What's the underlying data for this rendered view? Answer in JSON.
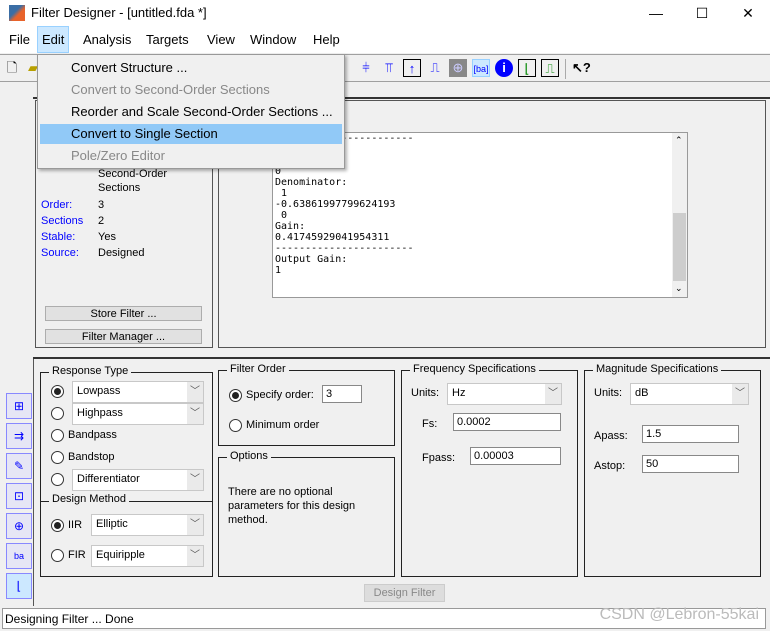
{
  "window": {
    "title": "Filter Designer -  [untitled.fda *]",
    "controls": [
      "—",
      "☐",
      "✕"
    ]
  },
  "menubar": [
    "File",
    "Edit",
    "Analysis",
    "Targets",
    "View",
    "Window",
    "Help"
  ],
  "edit_menu": {
    "items": [
      {
        "label": "Convert Structure ...",
        "enabled": true
      },
      {
        "label": "Convert to Second-Order Sections",
        "enabled": false
      },
      {
        "label": "Reorder and Scale Second-Order Sections ...",
        "enabled": true
      },
      {
        "label": "Convert to Single Section",
        "enabled": true,
        "highlighted": true
      },
      {
        "label": "Pole/Zero Editor",
        "enabled": false
      }
    ]
  },
  "toolbar": {
    "icons": [
      "new-file-icon",
      "open-file-icon",
      "phase-delay-icon",
      "group-delay-icon",
      "impulse-response-icon",
      "step-response-icon",
      "pole-zero-icon",
      "filter-coefficients-icon",
      "filter-information-icon",
      "magnitude-estimate-icon",
      "round-off-noise-icon",
      "whats-this-help-icon"
    ]
  },
  "filter_info": {
    "structure_tail": "Second-Order\nSections",
    "fields": [
      {
        "label": "Order:",
        "value": "3"
      },
      {
        "label": "Sections",
        "value": "2"
      },
      {
        "label": "Stable:",
        "value": "Yes"
      },
      {
        "label": "Source:",
        "value": "Designed"
      }
    ],
    "store_button": "Store Filter ...",
    "manager_button": "Filter Manager ..."
  },
  "coefficients_text": "-----------------------\n1\n1\n0\nDenominator:\n 1\n-0.63861997799624193\n 0\nGain:\n0.41745929041954311\n-----------------------\nOutput Gain:\n1",
  "response_type": {
    "title": "Response Type",
    "lowpass": "Lowpass",
    "highpass": "Highpass",
    "bandpass": "Bandpass",
    "bandstop": "Bandstop",
    "differentiator": "Differentiator",
    "selected": "Lowpass"
  },
  "design_method": {
    "title": "Design Method",
    "iir_label": "IIR",
    "iir_value": "Elliptic",
    "fir_label": "FIR",
    "fir_value": "Equiripple",
    "selected": "IIR"
  },
  "filter_order": {
    "title": "Filter Order",
    "specify_label": "Specify order:",
    "specify_value": "3",
    "minimum_label": "Minimum order",
    "selected": "specify"
  },
  "options": {
    "title": "Options",
    "text": "There are no optional parameters for this design method."
  },
  "frequency_specs": {
    "title": "Frequency Specifications",
    "units_label": "Units:",
    "units": "Hz",
    "fs_label": "Fs:",
    "fs": "0.0002",
    "fpass_label": "Fpass:",
    "fpass": "0.00003"
  },
  "magnitude_specs": {
    "title": "Magnitude Specifications",
    "units_label": "Units:",
    "units": "dB",
    "apass_label": "Apass:",
    "apass": "1.5",
    "astop_label": "Astop:",
    "astop": "50"
  },
  "design_button": "Design Filter",
  "status": "Designing Filter ... Done",
  "watermark": "CSDN @Lebron-55kai"
}
